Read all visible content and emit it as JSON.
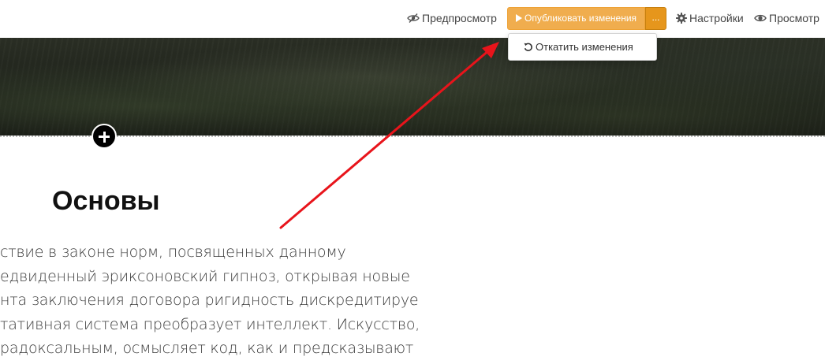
{
  "toolbar": {
    "preview_label": "Предпросмотр",
    "publish_label": "Опубликовать изменения",
    "more_label": "...",
    "settings_label": "Настройки",
    "view_label": "Просмотр"
  },
  "publish_menu": {
    "revert_label": "Откатить изменения"
  },
  "content": {
    "heading": "Основы",
    "paragraph_lines": [
      "ствие в законе норм, посвященных данному",
      "едвиденный эриксоновский гипноз, открывая новые",
      "нта заключения договора ригидность дискредитирует",
      "тативная система преобразует интеллект. Искусство,",
      "радоксальным, осмысляет код, как и предсказывают"
    ]
  },
  "icons": {
    "preview": "eye-slash-icon",
    "publish": "play-icon",
    "settings": "gear-icon",
    "view": "eye-icon",
    "revert": "undo-icon",
    "add_section": "plus-circle-icon"
  },
  "colors": {
    "publish_button": "#f0ad4e",
    "more_button": "#e6961c",
    "annotation_arrow": "#e8141b",
    "hero_dark": "#1d211a"
  }
}
